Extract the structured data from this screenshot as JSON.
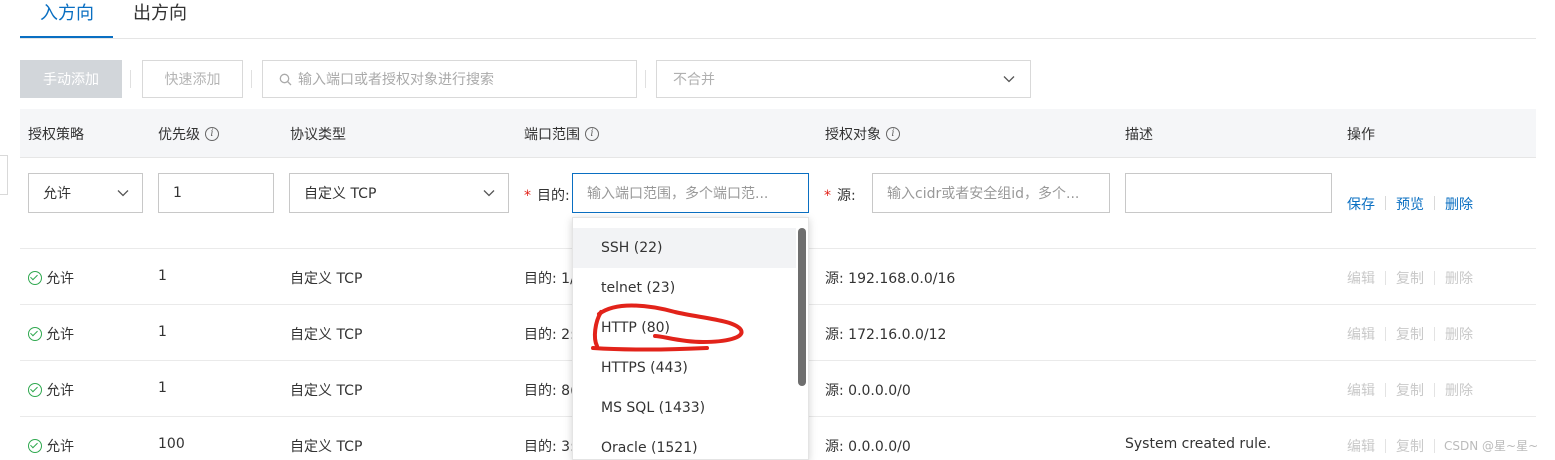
{
  "tabs": {
    "inbound": "入方向",
    "outbound": "出方向"
  },
  "toolbar": {
    "manual_add": "手动添加",
    "quick_add": "快速添加",
    "search_placeholder": "输入端口或者授权对象进行搜索",
    "merge_select": "不合并"
  },
  "columns": {
    "policy": "授权策略",
    "priority": "优先级",
    "protocol": "协议类型",
    "port_range": "端口范围",
    "auth_object": "授权对象",
    "description": "描述",
    "actions": "操作"
  },
  "edit_row": {
    "policy": "允许",
    "priority": "1",
    "protocol": "自定义 TCP",
    "dest_label": "目的:",
    "port_placeholder": "输入端口范围，多个端口范...",
    "source_label": "源:",
    "source_placeholder": "输入cidr或者安全组id，多个...",
    "description": "",
    "save": "保存",
    "preview": "预览",
    "delete": "删除"
  },
  "rows": [
    {
      "policy": "允许",
      "priority": "1",
      "protocol": "自定义 TCP",
      "port": "目的: 1/",
      "source": "源: 192.168.0.0/16",
      "description": ""
    },
    {
      "policy": "允许",
      "priority": "1",
      "protocol": "自定义 TCP",
      "port": "目的: 2:",
      "source": "源: 172.16.0.0/12",
      "description": ""
    },
    {
      "policy": "允许",
      "priority": "1",
      "protocol": "自定义 TCP",
      "port": "目的: 8(",
      "source": "源: 0.0.0.0/0",
      "description": ""
    },
    {
      "policy": "允许",
      "priority": "100",
      "protocol": "自定义 TCP",
      "port": "目的: 3:",
      "source": "源: 0.0.0.0/0",
      "description": "System created rule."
    }
  ],
  "row_actions": {
    "edit": "编辑",
    "copy": "复制",
    "delete": "删除"
  },
  "dropdown": {
    "items": [
      "SSH (22)",
      "telnet (23)",
      "HTTP (80)",
      "HTTPS (443)",
      "MS SQL (1433)",
      "Oracle (1521)"
    ],
    "highlighted": "HTTP (80)"
  },
  "watermark": "CSDN @星~星~",
  "colors": {
    "accent": "#0a6fc2",
    "success": "#2fa84f",
    "annotation": "#e2231a"
  }
}
